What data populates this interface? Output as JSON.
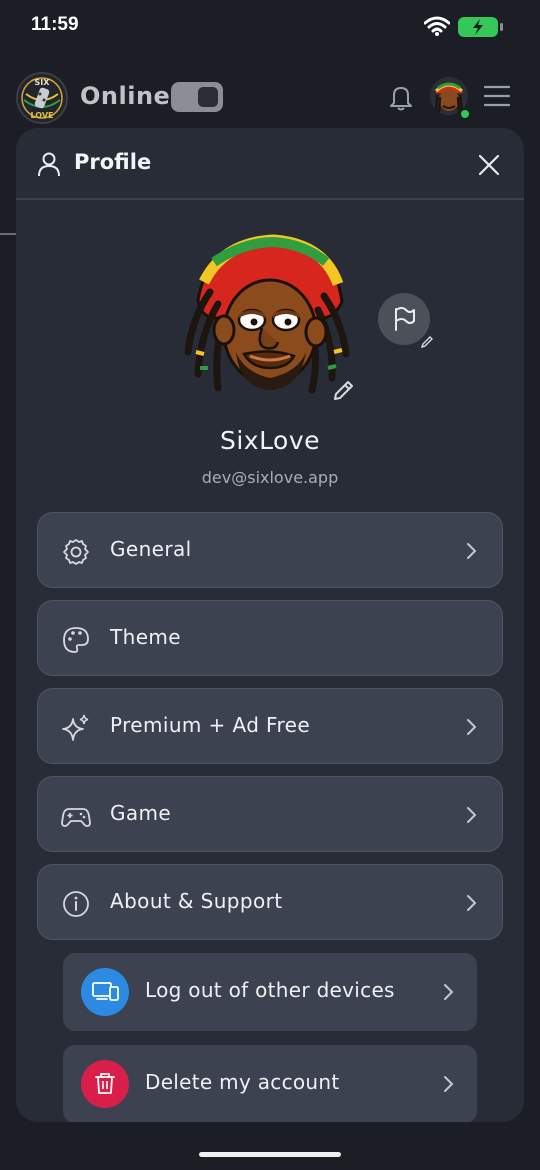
{
  "status_bar": {
    "time": "11:59"
  },
  "header": {
    "logo_text_top": "SIX",
    "logo_text_bottom": "LOVE",
    "online_label": "Online",
    "online_toggle_on": true
  },
  "panel": {
    "title": "Profile",
    "username": "SixLove",
    "email": "dev@sixlove.app",
    "menu": [
      {
        "label": "General",
        "icon": "gear-icon",
        "has_chevron": true
      },
      {
        "label": "Theme",
        "icon": "palette-icon",
        "has_chevron": false
      },
      {
        "label": "Premium + Ad Free",
        "icon": "sparkles-icon",
        "has_chevron": true
      },
      {
        "label": "Game",
        "icon": "gamepad-icon",
        "has_chevron": true
      },
      {
        "label": "About & Support",
        "icon": "info-icon",
        "has_chevron": true
      }
    ],
    "actions": [
      {
        "label": "Log out of other devices",
        "icon": "devices-icon",
        "color": "#2d8ae3"
      },
      {
        "label": "Delete my account",
        "icon": "trash-icon",
        "color": "#d91e4a"
      }
    ]
  },
  "colors": {
    "background": "#1b1e24",
    "panel": "#272c36",
    "menu_item": "#3c4250",
    "online_dot": "#34c759",
    "battery": "#34c759"
  }
}
